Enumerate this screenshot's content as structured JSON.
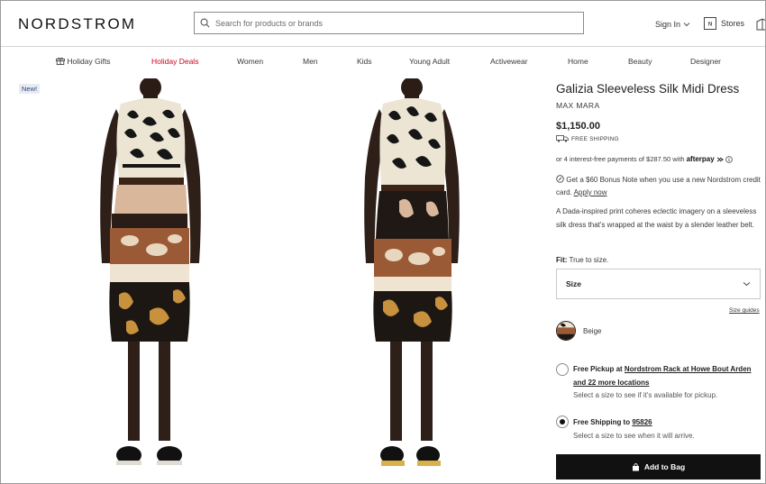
{
  "header": {
    "logo": "NORDSTROM",
    "search_placeholder": "Search for products or brands",
    "sign_in": "Sign In",
    "stores": "Stores"
  },
  "nav": {
    "items": [
      "Holiday Gifts",
      "Holiday Deals",
      "Women",
      "Men",
      "Kids",
      "Young Adult",
      "Activewear",
      "Home",
      "Beauty",
      "Designer"
    ]
  },
  "product": {
    "badge": "New!",
    "title": "Galizia Sleeveless Silk Midi Dress",
    "brand": "MAX MARA",
    "price": "$1,150.00",
    "free_shipping": "FREE SHIPPING",
    "afterpay_text": "or 4 interest-free payments of $287.50 with",
    "afterpay_brand": "afterpay",
    "bonus_text": "Get a $60 Bonus Note when you use a new Nordstrom credit card.",
    "bonus_link": "Apply now",
    "description": "A Dada-inspired print coheres eclectic imagery on a sleeveless silk dress that's wrapped at the waist by a slender leather belt.",
    "fit_label": "Fit:",
    "fit_value": "True to size.",
    "size_label": "Size",
    "size_guides": "Size guides",
    "color": "Beige"
  },
  "fulfillment": {
    "pickup_prefix": "Free Pickup at",
    "pickup_store": "Nordstrom Rack at Howe Bout Arden",
    "pickup_more": "and 22 more locations",
    "pickup_sub": "Select a size to see if it's available for pickup.",
    "shipping_prefix": "Free Shipping to",
    "shipping_zip": "95826",
    "shipping_sub": "Select a size to see when it will arrive.",
    "selected": "shipping"
  },
  "cta": {
    "add_to_bag": "Add to Bag"
  },
  "colors": {
    "deal_red": "#d4001f",
    "button_black": "#111111"
  }
}
